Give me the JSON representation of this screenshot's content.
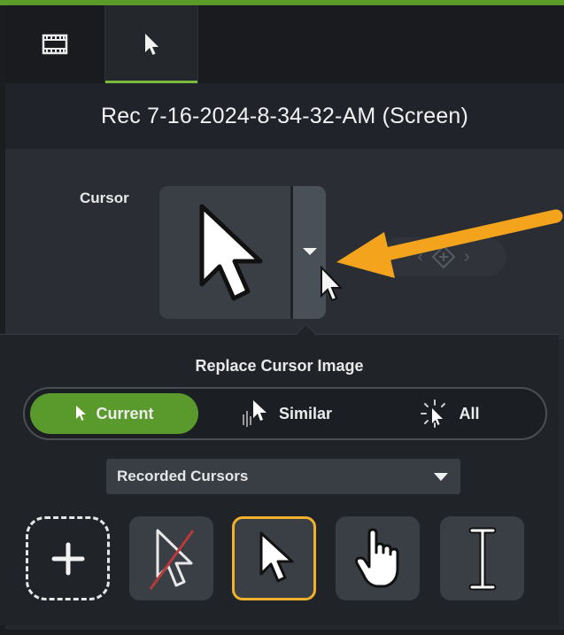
{
  "tabs": [
    {
      "icon": "film-strip-icon",
      "active": false
    },
    {
      "icon": "cursor-arrow-icon",
      "active": true
    }
  ],
  "clip_title": "Rec 7-16-2024-8-34-32-AM (Screen)",
  "cursor_property": {
    "label": "Cursor",
    "current_icon": "arrow-cursor-icon"
  },
  "popup": {
    "title": "Replace Cursor Image",
    "scope_options": [
      {
        "label": "Current",
        "icon": "pointer-icon",
        "selected": true
      },
      {
        "label": "Similar",
        "icon": "pointer-similar-icon",
        "selected": false
      },
      {
        "label": "All",
        "icon": "pointer-all-icon",
        "selected": false
      }
    ],
    "library_select": {
      "value": "Recorded Cursors"
    },
    "cursor_tiles": [
      {
        "icon": "add-icon",
        "selected": false
      },
      {
        "icon": "no-cursor-icon",
        "selected": false
      },
      {
        "icon": "arrow-cursor-icon",
        "selected": true
      },
      {
        "icon": "hand-cursor-icon",
        "selected": false
      },
      {
        "icon": "ibeam-cursor-icon",
        "selected": false
      }
    ]
  },
  "colors": {
    "accent_green": "#5a9a2c",
    "selected_outline": "#f2b12a",
    "annotation_arrow": "#f3a41c"
  }
}
